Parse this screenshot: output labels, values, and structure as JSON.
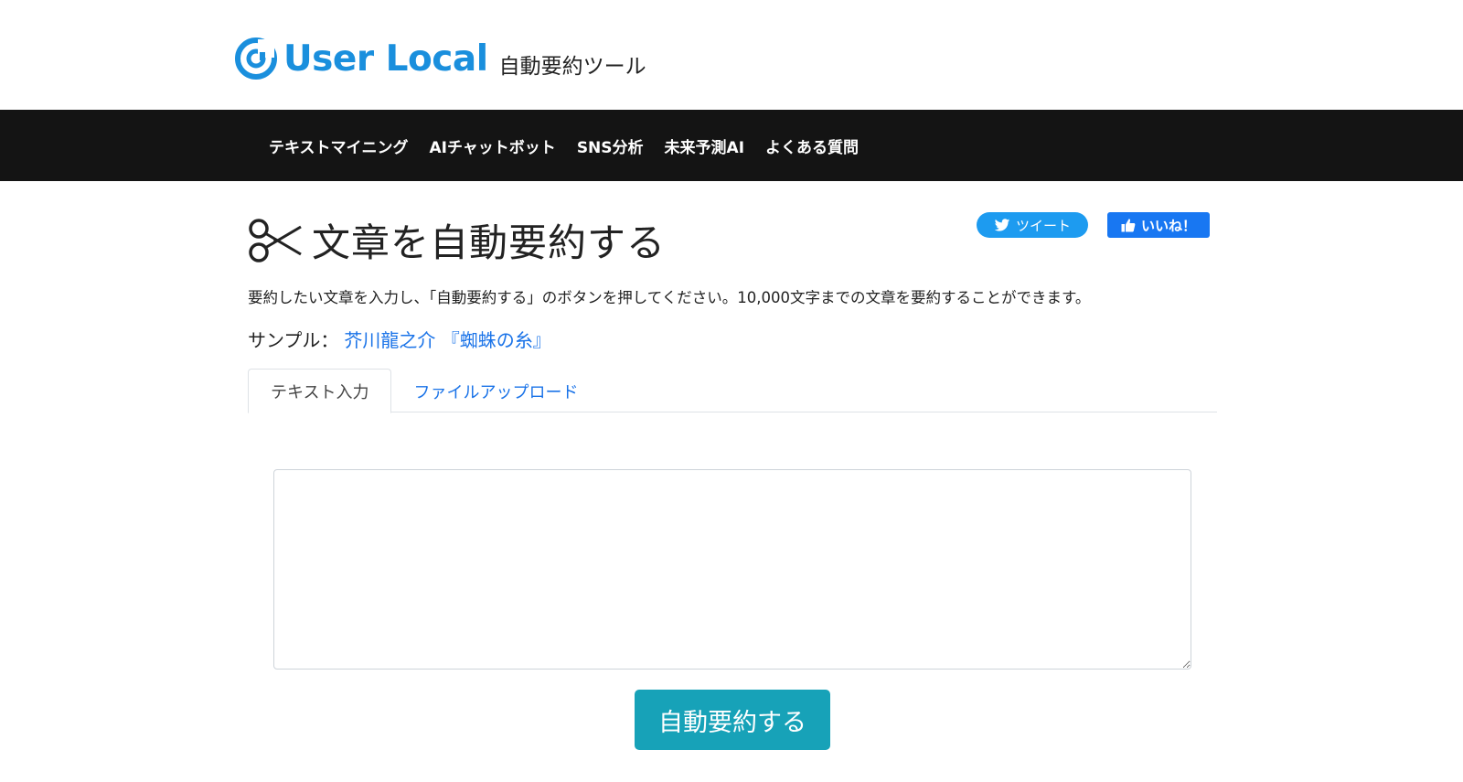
{
  "header": {
    "logo_text": "User Local",
    "logo_subtitle": "自動要約ツール",
    "brand_color": "#1a8fdd"
  },
  "nav": {
    "items": [
      {
        "label": "テキストマイニング"
      },
      {
        "label": "AIチャットボット"
      },
      {
        "label": "SNS分析"
      },
      {
        "label": "未来予測AI"
      },
      {
        "label": "よくある質問"
      }
    ]
  },
  "main": {
    "title": "文章を自動要約する",
    "title_icon": "scissors-icon",
    "description": "要約したい文章を入力し、「自動要約する」のボタンを押してください。10,000文字までの文章を要約することができます。",
    "sample_label": "サンプル：",
    "sample_link": "芥川龍之介 『蜘蛛の糸』",
    "tabs": [
      {
        "label": "テキスト入力",
        "active": true
      },
      {
        "label": "ファイルアップロード",
        "active": false
      }
    ],
    "textarea_value": "",
    "submit_label": "自動要約する"
  },
  "share": {
    "tweet_label": "ツイート",
    "tweet_color": "#1d9bf0",
    "like_label": "いいね！",
    "like_color": "#1877f2"
  }
}
